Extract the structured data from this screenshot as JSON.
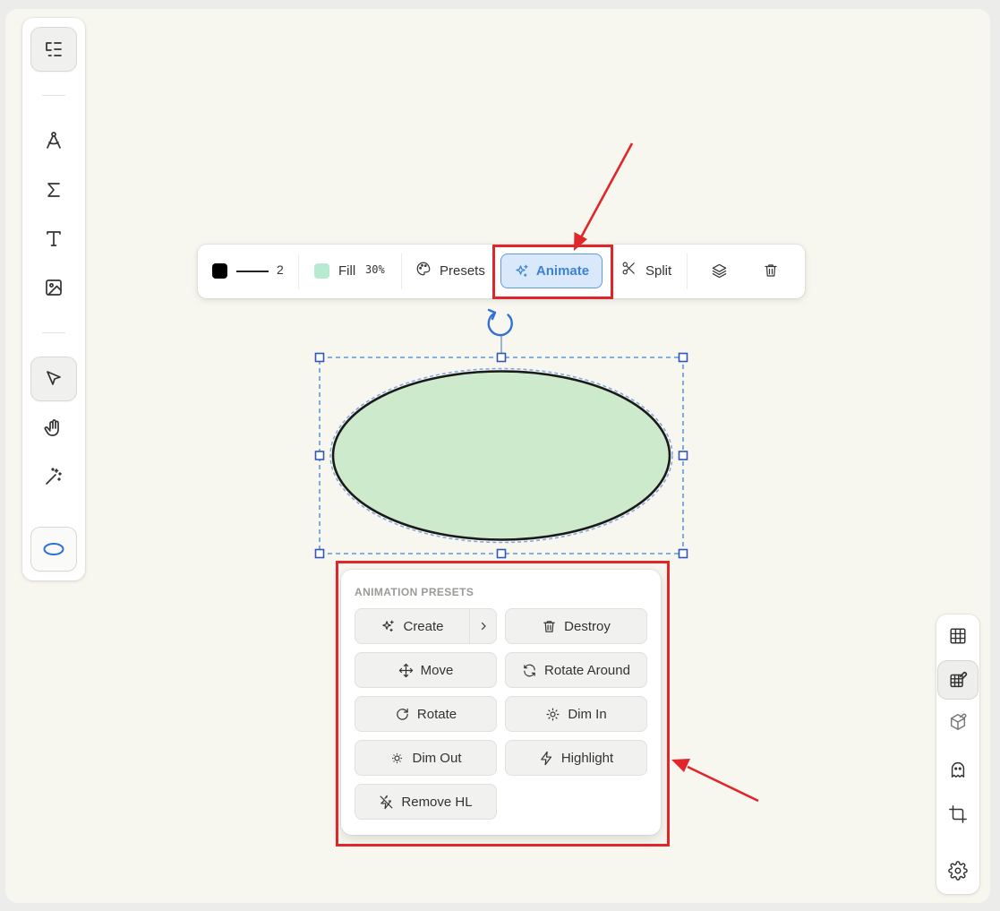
{
  "property_bar": {
    "stroke_color": "#000000",
    "stroke_width": "2",
    "fill_color": "#b7ead0",
    "fill_label": "Fill",
    "fill_opacity": "30%",
    "presets_label": "Presets",
    "animate_label": "Animate",
    "split_label": "Split"
  },
  "shape": {
    "type": "ellipse",
    "fill": "#cdeacc",
    "stroke": "#1a1a1a",
    "selection_color": "#2f6fd6"
  },
  "presets_panel": {
    "title": "ANIMATION PRESETS",
    "buttons": [
      {
        "label": "Create",
        "icon": "sparkles-icon"
      },
      {
        "label": "Destroy",
        "icon": "trash-icon"
      },
      {
        "label": "Move",
        "icon": "move-icon"
      },
      {
        "label": "Rotate Around",
        "icon": "refresh-icon"
      },
      {
        "label": "Rotate",
        "icon": "rotate-cw-icon"
      },
      {
        "label": "Dim In",
        "icon": "sun-icon"
      },
      {
        "label": "Dim Out",
        "icon": "sun-dim-icon"
      },
      {
        "label": "Highlight",
        "icon": "zap-icon"
      },
      {
        "label": "Remove HL",
        "icon": "zap-off-icon"
      }
    ]
  },
  "left_toolbar": {
    "tools": [
      "list-tree-icon",
      "compass-icon",
      "sigma-icon",
      "text-icon",
      "image-icon",
      "pointer-icon",
      "hand-icon",
      "magic-wand-icon",
      "ellipse-icon"
    ]
  },
  "right_toolbar": {
    "tools": [
      "grid-icon",
      "grid-snap-icon",
      "3d-box-icon",
      "ghost-icon",
      "crop-icon",
      "settings-icon"
    ]
  },
  "accent_color": "#3b82d6",
  "highlight_color": "#e0262b"
}
